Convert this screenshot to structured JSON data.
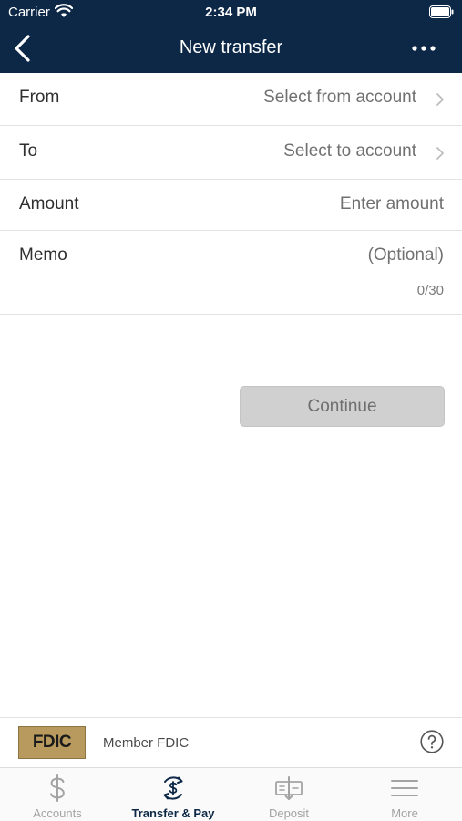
{
  "status_bar": {
    "carrier": "Carrier",
    "time": "2:34 PM"
  },
  "nav": {
    "title": "New transfer",
    "back_icon": "chevron-left-icon",
    "more_icon": "ellipsis-icon"
  },
  "form": {
    "from": {
      "label": "From",
      "value": "Select from account"
    },
    "to": {
      "label": "To",
      "value": "Select to account"
    },
    "amount": {
      "label": "Amount",
      "placeholder": "Enter amount"
    },
    "memo": {
      "label": "Memo",
      "placeholder": "(Optional)",
      "counter": "0/30"
    }
  },
  "continue_label": "Continue",
  "fdic": {
    "logo_text": "FDIC",
    "text": "Member FDIC"
  },
  "tabs": [
    {
      "label": "Accounts",
      "icon": "dollar-icon",
      "active": false
    },
    {
      "label": "Transfer & Pay",
      "icon": "transfer-icon",
      "active": true
    },
    {
      "label": "Deposit",
      "icon": "check-deposit-icon",
      "active": false
    },
    {
      "label": "More",
      "icon": "menu-icon",
      "active": false
    }
  ],
  "colors": {
    "header": "#0d2847",
    "button_disabled": "#d0d0d0",
    "tab_active": "#0d2847",
    "tab_inactive": "#a3a3a3",
    "fdic_gold": "#b89a5e"
  }
}
